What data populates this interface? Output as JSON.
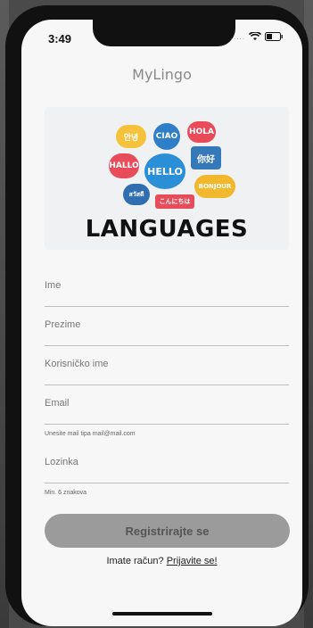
{
  "status": {
    "time": "3:49",
    "signal": "....."
  },
  "app": {
    "title": "MyLingo"
  },
  "hero": {
    "caption": "LANGUAGES",
    "bubbles": [
      "안녕",
      "CIAO",
      "HOLA",
      "HALLO",
      "HELLO",
      "你好",
      "สวัสดี",
      "BONJOUR",
      "こんにちは"
    ]
  },
  "form": {
    "first_name_label": "Ime",
    "last_name_label": "Prezime",
    "username_label": "Korisničko ime",
    "email_label": "Email",
    "email_helper": "Unesite mail tipa mail@mail.com",
    "password_label": "Lozinka",
    "password_helper": "Min. 6 znakova",
    "submit_label": "Registrirajte se"
  },
  "login": {
    "prompt": "Imate račun?",
    "link": "Prijavite se!"
  }
}
